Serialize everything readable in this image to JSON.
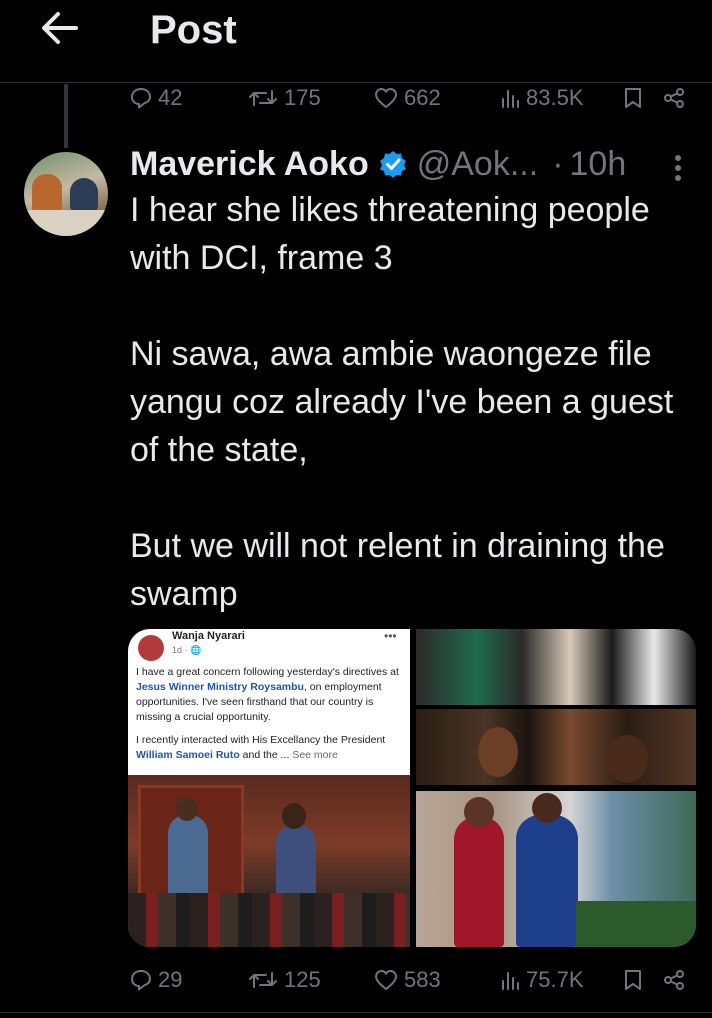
{
  "header": {
    "title": "Post"
  },
  "previous_post": {
    "actions": {
      "replies": "42",
      "reposts": "175",
      "likes": "662",
      "views": "83.5K"
    }
  },
  "post": {
    "author_name": "Maverick Aoko",
    "handle": "@Aok...",
    "separator": "·",
    "time": "10h",
    "paragraphs": [
      "I hear she likes threatening people with DCI, frame 3",
      "Ni sawa, awa ambie waongeze file yangu coz already I've been a guest of the state,",
      "But we will not relent in draining the swamp"
    ],
    "media": {
      "screenshot": {
        "name": "Wanja Nyarari",
        "meta": "1d · ",
        "body_1_a": "I have a great concern following yesterday's directives at ",
        "body_1_link": "Jesus Winner Ministry Roysambu",
        "body_1_b": ", on employment opportunities. I've seen firsthand that our country is missing a crucial opportunity.",
        "body_2_a": "I recently interacted with His Excellancy the President ",
        "body_2_link": "William Samoei Ruto",
        "body_2_b": " and the ... ",
        "see_more": "See more",
        "dots": "•••"
      }
    },
    "actions": {
      "replies": "29",
      "reposts": "125",
      "likes": "583",
      "views": "75.7K"
    }
  },
  "colors": {
    "background": "#000000",
    "text": "#e7e9ea",
    "muted": "#71767b",
    "verified": "#1d9bf0",
    "link": "#1c56b0"
  },
  "icons": [
    "back-arrow-icon",
    "reply-icon",
    "repost-icon",
    "like-icon",
    "views-icon",
    "bookmark-icon",
    "share-icon",
    "verified-badge-icon",
    "more-icon"
  ]
}
